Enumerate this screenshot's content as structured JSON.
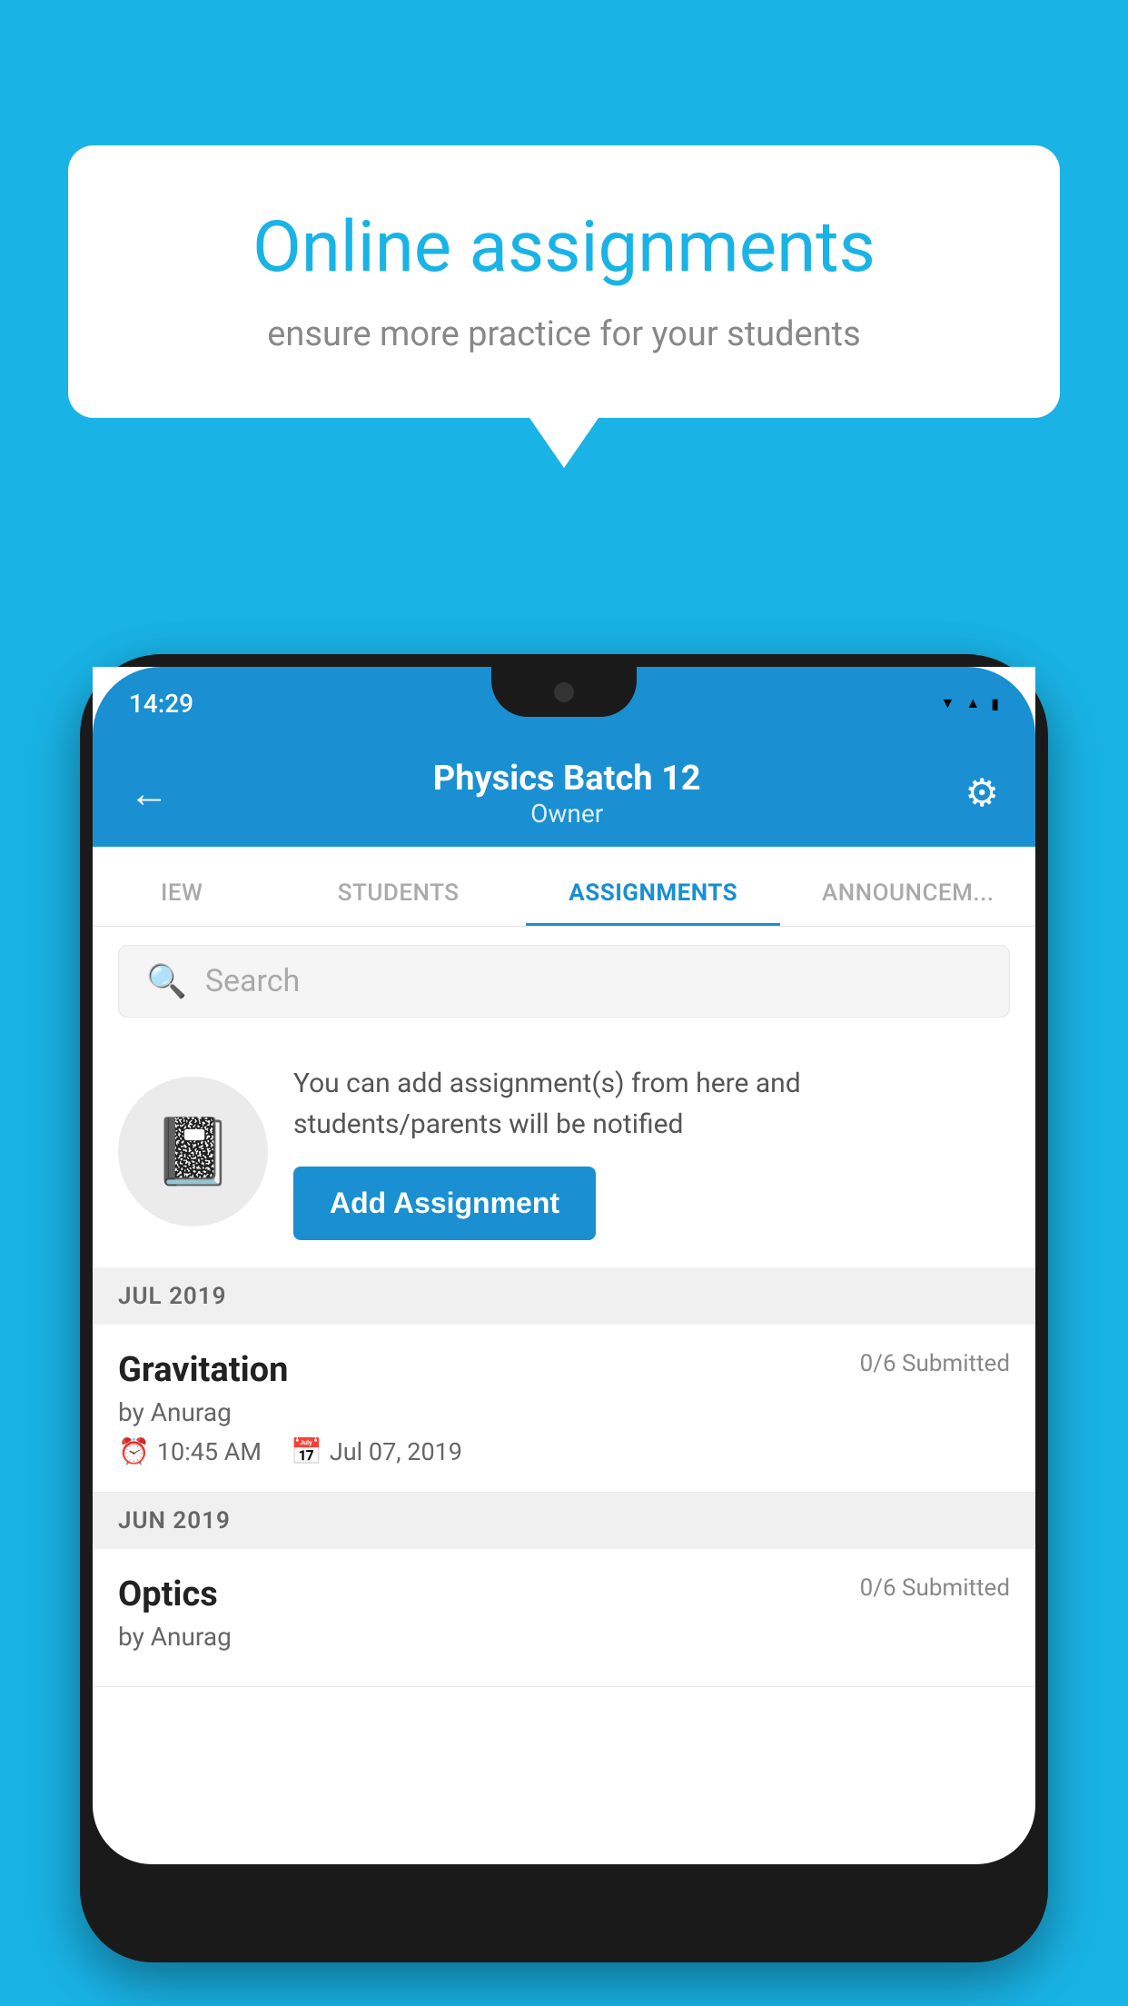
{
  "background_color": "#19b3e6",
  "speech_bubble": {
    "title": "Online assignments",
    "subtitle": "ensure more practice for your students"
  },
  "phone": {
    "status_bar": {
      "time": "14:29",
      "icons": [
        "wifi",
        "signal",
        "battery"
      ]
    },
    "app_header": {
      "title": "Physics Batch 12",
      "subtitle": "Owner",
      "back_label": "←",
      "settings_label": "⚙"
    },
    "tabs": [
      {
        "label": "IEW",
        "active": false
      },
      {
        "label": "STUDENTS",
        "active": false
      },
      {
        "label": "ASSIGNMENTS",
        "active": true
      },
      {
        "label": "ANNOUNCEM...",
        "active": false
      }
    ],
    "search": {
      "placeholder": "Search"
    },
    "promo": {
      "description": "You can add assignment(s) from here and students/parents will be notified",
      "button_label": "Add Assignment"
    },
    "assignments": [
      {
        "section": "JUL 2019",
        "items": [
          {
            "title": "Gravitation",
            "submitted": "0/6 Submitted",
            "author": "by Anurag",
            "time": "10:45 AM",
            "date": "Jul 07, 2019"
          }
        ]
      },
      {
        "section": "JUN 2019",
        "items": [
          {
            "title": "Optics",
            "submitted": "0/6 Submitted",
            "author": "by Anurag",
            "time": "",
            "date": ""
          }
        ]
      }
    ]
  }
}
